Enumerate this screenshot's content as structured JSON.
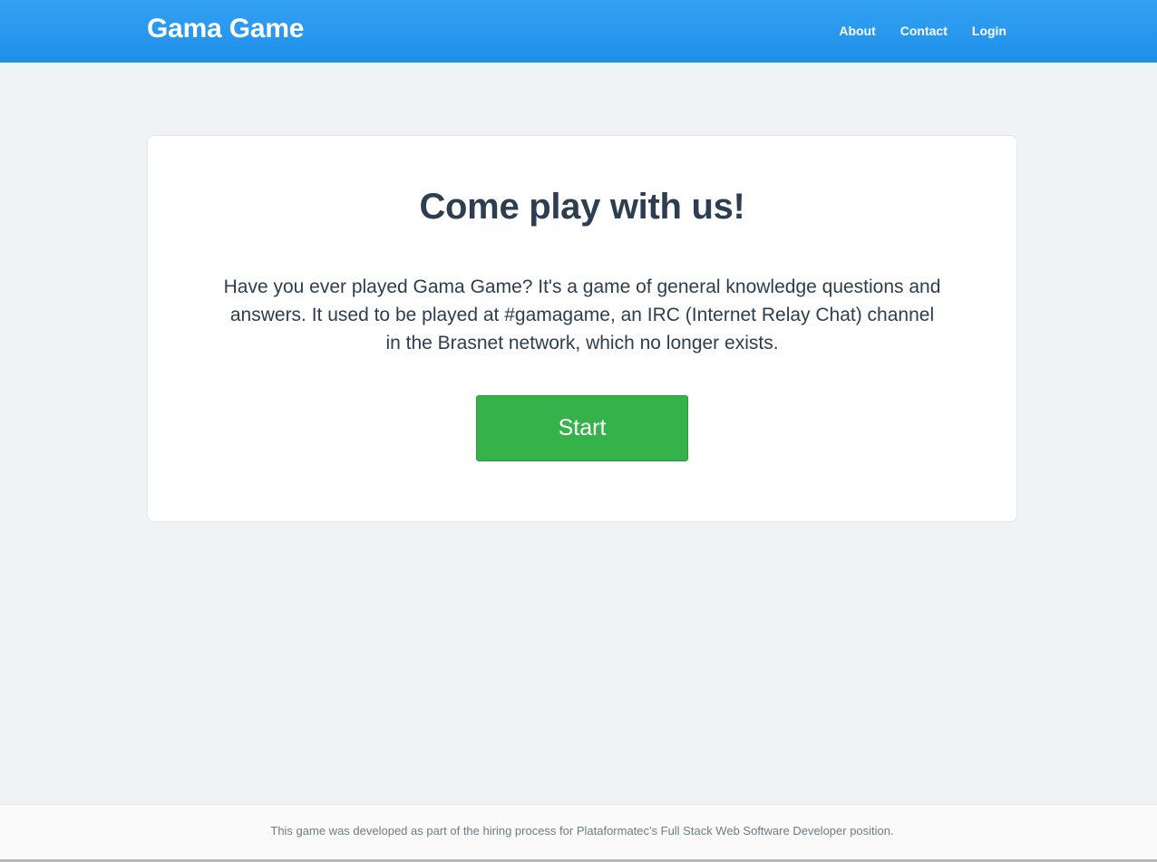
{
  "navbar": {
    "brand": "Gama Game",
    "links": [
      {
        "label": "About"
      },
      {
        "label": "Contact"
      },
      {
        "label": "Login"
      }
    ]
  },
  "main": {
    "title": "Come play with us!",
    "description": "Have you ever played Gama Game? It's a game of general knowledge questions and answers. It used to be played at #gamagame, an IRC (Internet Relay Chat) channel in the Brasnet network, which no longer exists.",
    "start_label": "Start"
  },
  "footer": {
    "text": "This game was developed as part of the hiring process for Plataformatec's Full Stack Web Software Developer position."
  },
  "colors": {
    "navbar": "#2496ee",
    "background": "#eff3f6",
    "start_button": "#35b34a",
    "heading": "#2c3e50"
  }
}
